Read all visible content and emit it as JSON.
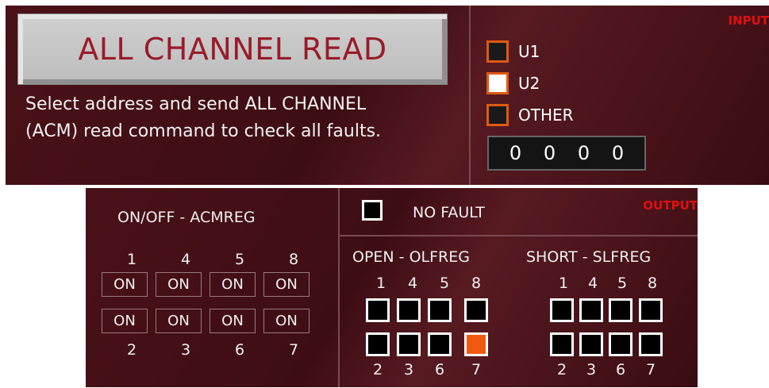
{
  "top": {
    "read_button": "ALL CHANNEL READ",
    "desc_line1": "Select address and send ALL CHANNEL",
    "desc_line2": "(ACM) read command to check all faults.",
    "input_label": "INPUT",
    "options": [
      {
        "label": "U1",
        "checked": false
      },
      {
        "label": "U2",
        "checked": true
      },
      {
        "label": "OTHER",
        "checked": false
      }
    ],
    "address_digits": [
      "0",
      "0",
      "0",
      "0"
    ]
  },
  "bottom": {
    "acmreg_title": "ON/OFF - ACMREG",
    "acm_top_numbers": [
      "1",
      "4",
      "5",
      "8"
    ],
    "acm_row1": [
      "ON",
      "ON",
      "ON",
      "ON"
    ],
    "acm_row2": [
      "ON",
      "ON",
      "ON",
      "ON"
    ],
    "acm_bottom_numbers": [
      "2",
      "3",
      "6",
      "7"
    ],
    "output_label": "OUTPUT",
    "no_fault_label": "NO FAULT",
    "open_title": "OPEN - OLFREG",
    "short_title": "SHORT - SLFREG",
    "open_top_numbers": [
      "1",
      "4",
      "5",
      "8"
    ],
    "open_bottom_numbers": [
      "2",
      "3",
      "6",
      "7"
    ],
    "short_top_numbers": [
      "1",
      "4",
      "5",
      "8"
    ],
    "short_bottom_numbers": [
      "2",
      "3",
      "6",
      "7"
    ],
    "open_active": [
      false,
      false,
      false,
      false,
      false,
      false,
      false,
      true
    ],
    "short_active": [
      false,
      false,
      false,
      false,
      false,
      false,
      false,
      false
    ],
    "colors": {
      "active": "#f05a10",
      "panel": "#4a1118",
      "accent_red": "#e01010"
    }
  }
}
